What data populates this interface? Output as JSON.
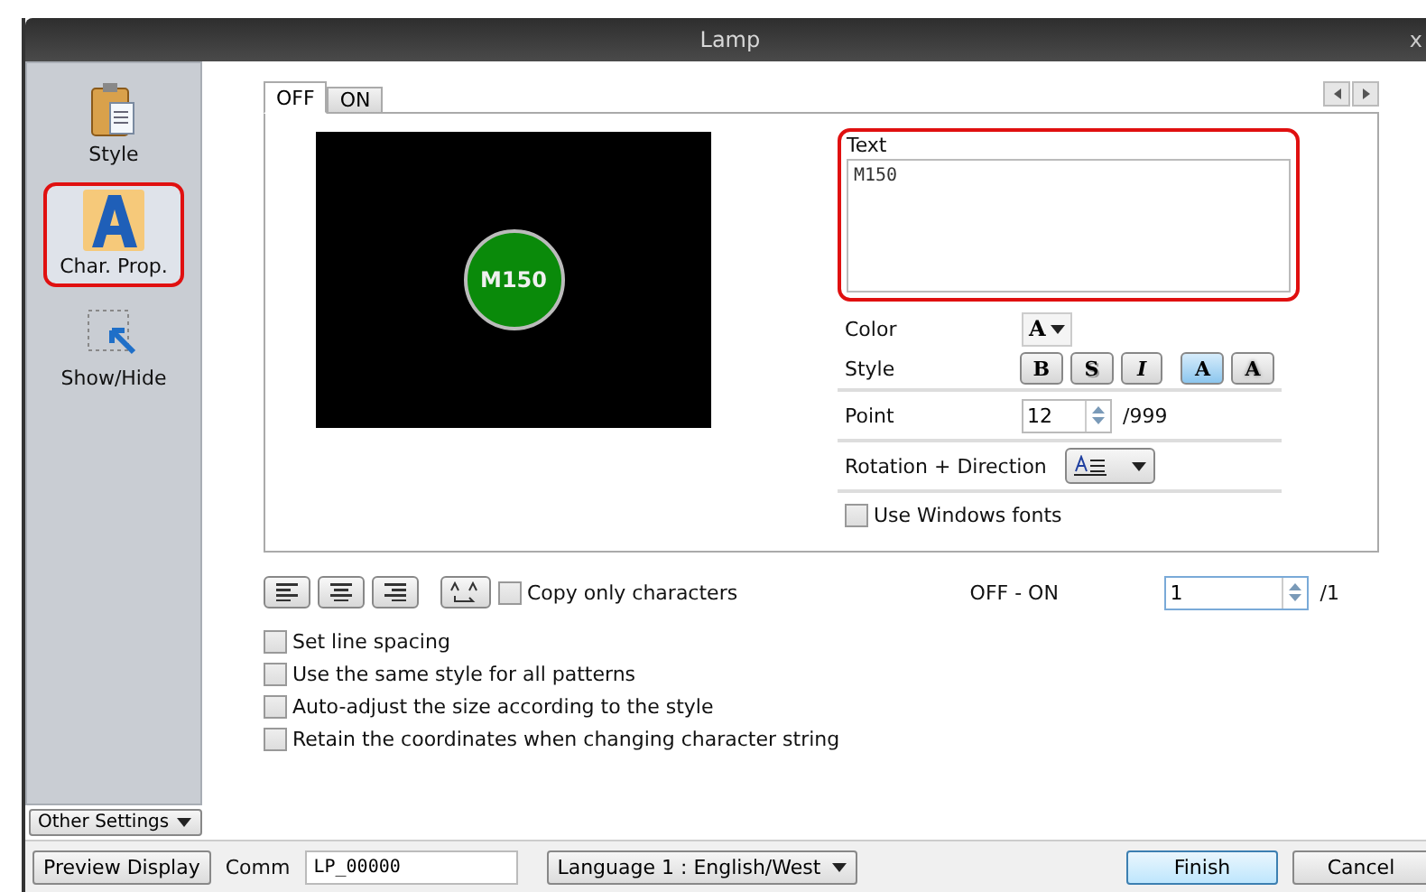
{
  "window": {
    "title": "Lamp",
    "close": "x"
  },
  "sidebar": {
    "items": [
      {
        "label": "Style",
        "selected": false,
        "highlighted": false
      },
      {
        "label": "Char. Prop.",
        "selected": true,
        "highlighted": true
      },
      {
        "label": "Show/Hide",
        "selected": false,
        "highlighted": false
      }
    ],
    "other_settings": "Other Settings"
  },
  "tabs": [
    {
      "label": "OFF",
      "selected": true
    },
    {
      "label": "ON",
      "selected": false
    }
  ],
  "preview": {
    "lamp_text": "M150"
  },
  "text_field": {
    "label": "Text",
    "value": "M150",
    "highlighted": true
  },
  "color": {
    "label": "Color",
    "glyph": "A"
  },
  "style": {
    "label": "Style",
    "buttons": [
      {
        "kind": "bold",
        "glyph": "B",
        "selected": false
      },
      {
        "kind": "shadow",
        "glyph": "S",
        "selected": false
      },
      {
        "kind": "italic",
        "glyph": "I",
        "selected": false
      },
      {
        "kind": "normal",
        "glyph": "A",
        "selected": true
      },
      {
        "kind": "outline",
        "glyph": "A",
        "selected": false
      }
    ]
  },
  "point": {
    "label": "Point",
    "value": "12",
    "max": "/999"
  },
  "rotation": {
    "label": "Rotation + Direction"
  },
  "windows_fonts": {
    "label": "Use Windows fonts",
    "checked": false
  },
  "copy_only": {
    "label": "Copy only characters",
    "checked": false
  },
  "off_on": {
    "label": "OFF - ON",
    "value": "1",
    "max": "/1"
  },
  "options": [
    {
      "label": "Set line spacing",
      "checked": false
    },
    {
      "label": "Use the same style for all patterns",
      "checked": false
    },
    {
      "label": "Auto-adjust the size according to the style",
      "checked": false
    },
    {
      "label": "Retain the coordinates when changing character string",
      "checked": false
    }
  ],
  "footer": {
    "preview_button": "Preview Display",
    "comm_label": "Comm",
    "comm_value": "LP_00000",
    "language": "Language 1 : English/West",
    "finish": "Finish",
    "cancel": "Cancel"
  }
}
